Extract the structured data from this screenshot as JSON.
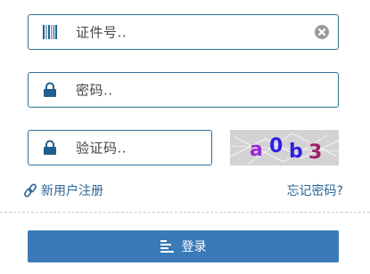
{
  "form": {
    "id_field": {
      "placeholder": "证件号..",
      "icon": "barcode-icon",
      "clear_icon": "clear-icon"
    },
    "password_field": {
      "placeholder": "密码..",
      "icon": "lock-icon"
    },
    "captcha_field": {
      "placeholder": "验证码..",
      "icon": "lock-icon"
    },
    "captcha_image": {
      "text": [
        "a",
        "0",
        "b",
        "3"
      ],
      "colors": [
        "#9b27d6",
        "#2d1ee8",
        "#2d1ee8",
        "#a0206a"
      ]
    },
    "register_link": {
      "label": "新用户注册",
      "icon": "link-icon"
    },
    "forgot_link": {
      "label": "忘记密码?"
    },
    "login_button": {
      "label": "登录",
      "icon": "align-left-icon"
    }
  },
  "colors": {
    "border": "#2f6f96",
    "icon": "#1f5f8b",
    "button": "#3a7ab7",
    "link": "#2a6495"
  }
}
